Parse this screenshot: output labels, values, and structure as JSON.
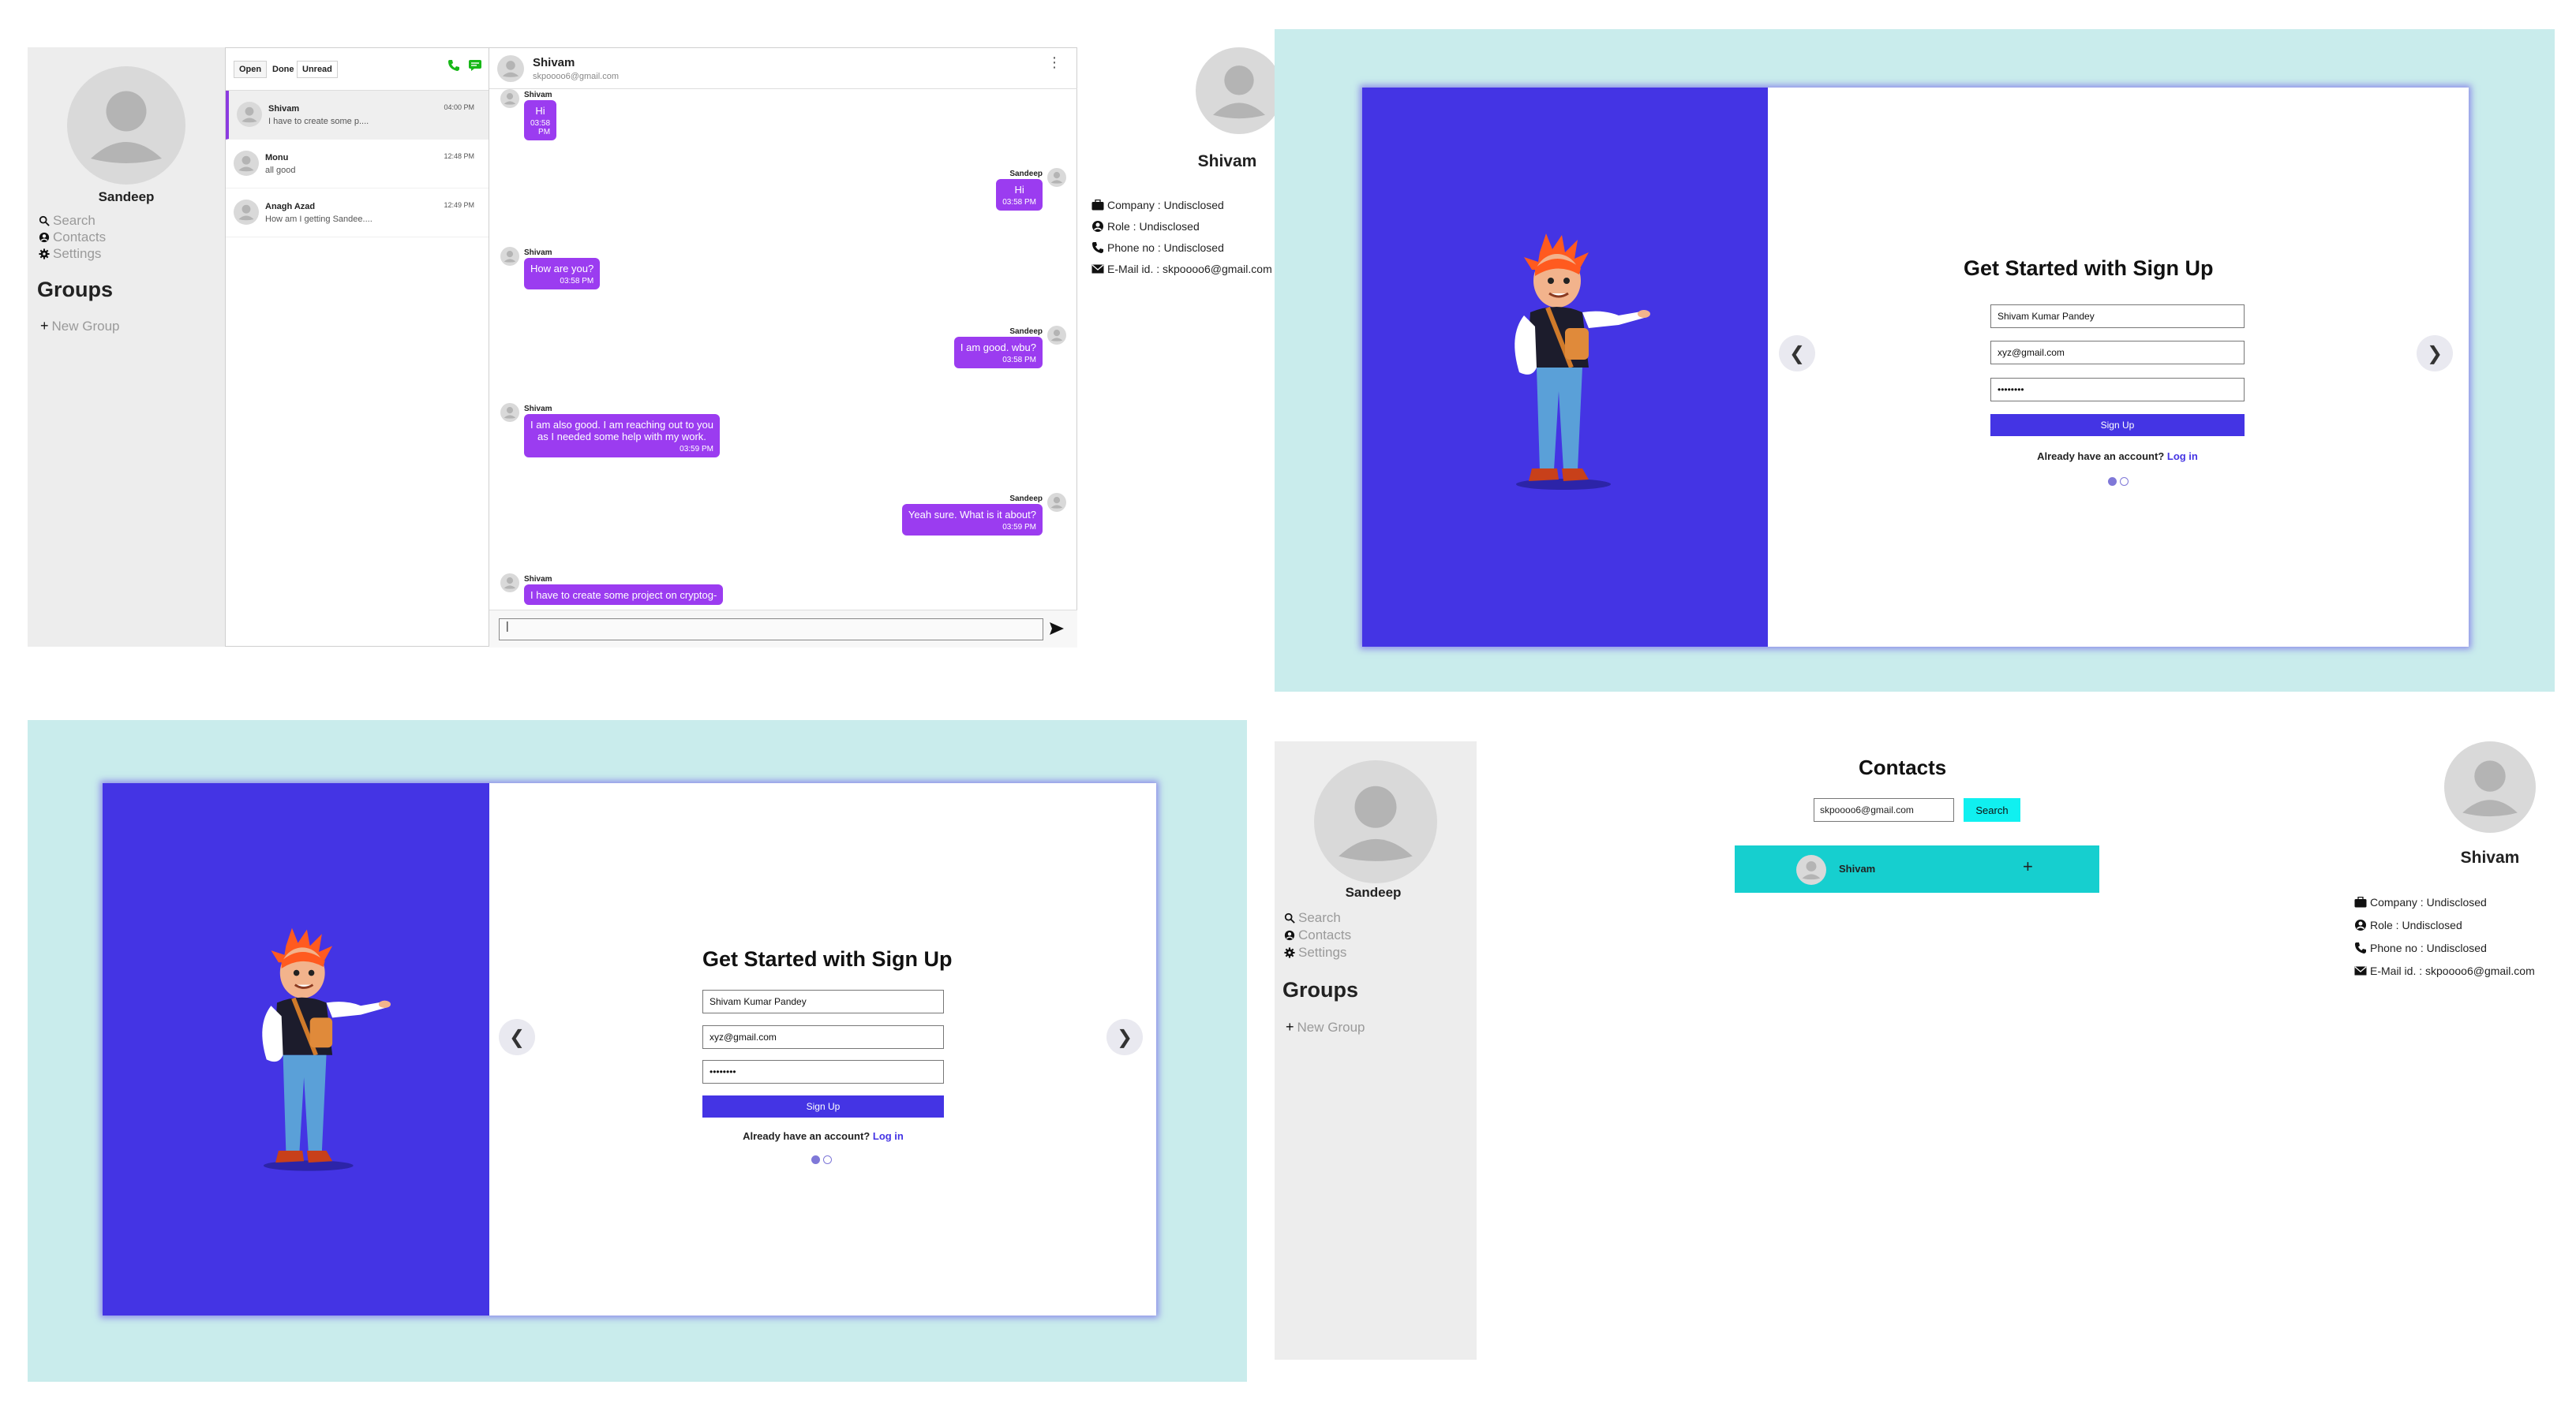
{
  "sidebar": {
    "user_name": "Sandeep",
    "links": [
      {
        "label": "Search",
        "icon": "search-icon"
      },
      {
        "label": "Contacts",
        "icon": "user-circle-icon"
      },
      {
        "label": "Settings",
        "icon": "gear-icon"
      }
    ],
    "groups_heading": "Groups",
    "new_group_label": "New Group"
  },
  "chat_list": {
    "tabs": [
      "Open",
      "Done",
      "Unread"
    ],
    "items": [
      {
        "name": "Shivam",
        "preview": "I have to create some p....",
        "time": "04:00 PM"
      },
      {
        "name": "Monu",
        "preview": "all good",
        "time": "12:48 PM"
      },
      {
        "name": "Anagh Azad",
        "preview": "How am I getting Sandee....",
        "time": "12:49 PM"
      }
    ]
  },
  "chat": {
    "contact_name": "Shivam",
    "contact_email": "skpoooo6@gmail.com",
    "input_value": "|",
    "messages": [
      {
        "sender": "Shivam",
        "text": "Hi",
        "time": "03:58 PM",
        "mine": false
      },
      {
        "sender": "Sandeep",
        "text": "Hi",
        "time": "03:58 PM",
        "mine": true
      },
      {
        "sender": "Shivam",
        "text": "How are you?",
        "time": "03:58 PM",
        "mine": false
      },
      {
        "sender": "Sandeep",
        "text": "I am good. wbu?",
        "time": "03:58 PM",
        "mine": true
      },
      {
        "sender": "Shivam",
        "text_lines": [
          "I am also good. I am reaching out to you",
          "as I needed some help with my work."
        ],
        "time": "03:59 PM",
        "mine": false
      },
      {
        "sender": "Sandeep",
        "text": "Yeah sure. What is it about?",
        "time": "03:59 PM",
        "mine": true
      },
      {
        "sender": "Shivam",
        "text": "I have to create some project on cryptog-",
        "time": "",
        "mine": false
      }
    ]
  },
  "profile": {
    "name": "Shivam",
    "rows": [
      {
        "label": "Company : Undisclosed",
        "icon": "briefcase-icon"
      },
      {
        "label": "Role : Undisclosed",
        "icon": "user-circle-icon"
      },
      {
        "label": "Phone no : Undisclosed",
        "icon": "phone-icon"
      },
      {
        "label": "E-Mail id. : skpoooo6@gmail.com",
        "icon": "mail-icon"
      }
    ]
  },
  "signup": {
    "title": "Get Started with Sign Up",
    "name_value": "Shivam Kumar Pandey",
    "email_value": "xyz@gmail.com",
    "password_value": "••••••••",
    "button_label": "Sign Up",
    "login_prompt": "Already have an account?",
    "login_link": "Log in",
    "prev_arrow": "❮",
    "next_arrow": "❯"
  },
  "contacts": {
    "title": "Contacts",
    "search_value": "skpoooo6@gmail.com",
    "search_button": "Search",
    "results": [
      {
        "name": "Shivam",
        "action": "+"
      }
    ]
  },
  "colors": {
    "accent": "#4434e4",
    "bubble": "#9b3cf0",
    "panel_bg": "#c9ecec",
    "contact_row": "#16cfcf",
    "search_btn": "#10f0f0"
  }
}
